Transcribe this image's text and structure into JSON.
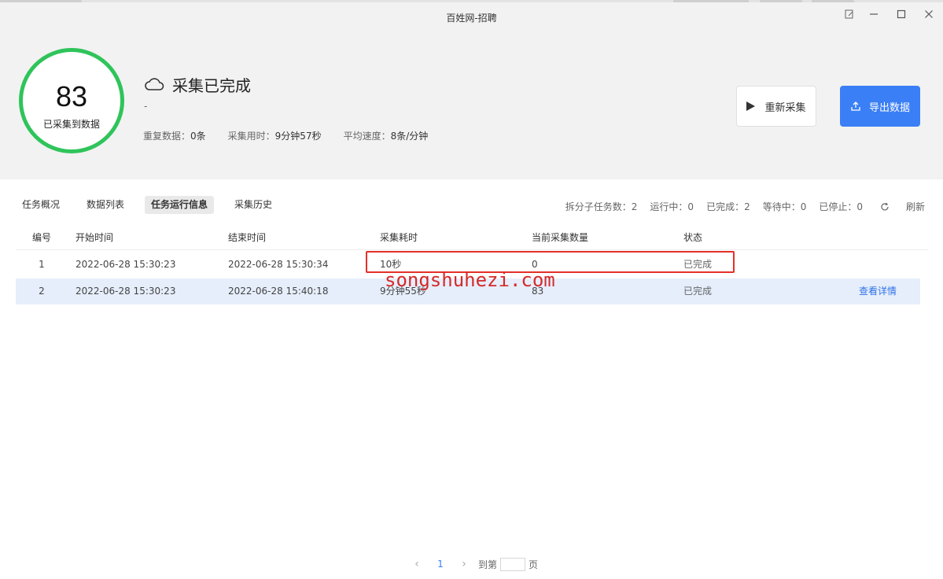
{
  "window": {
    "title": "百姓网-招聘"
  },
  "progress": {
    "count": "83",
    "label": "已采集到数据"
  },
  "status": {
    "title": "采集已完成",
    "subtitle": "-"
  },
  "stats": {
    "duplicate_label": "重复数据：",
    "duplicate_value": "0条",
    "time_label": "采集用时：",
    "time_value": "9分钟57秒",
    "speed_label": "平均速度：",
    "speed_value": "8条/分钟"
  },
  "buttons": {
    "recollect": "重新采集",
    "export": "导出数据"
  },
  "tabs": [
    "任务概况",
    "数据列表",
    "任务运行信息",
    "采集历史"
  ],
  "active_tab": "任务运行信息",
  "summary": {
    "split": "拆分子任务数：2",
    "running": "运行中：0",
    "completed": "已完成：2",
    "waiting": "等待中：0",
    "stopped": "已停止：0",
    "refresh": "刷新"
  },
  "table": {
    "headers": [
      "编号",
      "开始时间",
      "结束时间",
      "采集耗时",
      "当前采集数量",
      "状态"
    ],
    "rows": [
      {
        "id": "1",
        "start": "2022-06-28 15:30:23",
        "end": "2022-06-28 15:30:34",
        "duration": "10秒",
        "count": "0",
        "status": "已完成",
        "action": ""
      },
      {
        "id": "2",
        "start": "2022-06-28 15:30:23",
        "end": "2022-06-28 15:40:18",
        "duration": "9分钟55秒",
        "count": "83",
        "status": "已完成",
        "action": "查看详情"
      }
    ]
  },
  "watermark": "songshuhezi.com",
  "pager": {
    "current": "1",
    "goto_prefix": "到第",
    "goto_suffix": "页"
  },
  "colors": {
    "accent": "#3a7ff5",
    "success": "#2fc45a",
    "highlight": "#e4302a"
  }
}
